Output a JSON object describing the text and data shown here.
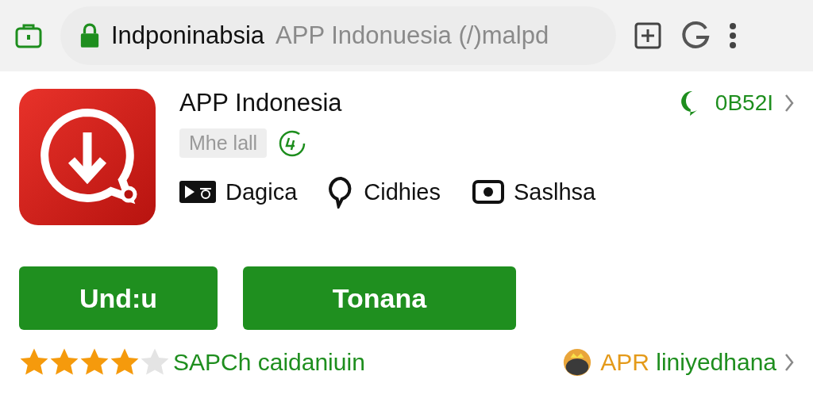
{
  "browser": {
    "url_host": "Indponinabsia",
    "url_rest": "APP Indonuesia (/)malpd"
  },
  "app": {
    "name": "APP Indonesia",
    "tag": "Mhe lall",
    "badge": "0B52I",
    "features": [
      {
        "kind": "video",
        "label": "Dagica"
      },
      {
        "kind": "chat",
        "label": "Cidhies"
      },
      {
        "kind": "camera",
        "label": "Saslhsa"
      }
    ]
  },
  "buttons": [
    "Und:u",
    "Tonana"
  ],
  "rating": {
    "stars": 4,
    "label": "SAPCh caidaniuin"
  },
  "promo": {
    "prefix": "APR",
    "text": "liniyedhana"
  }
}
